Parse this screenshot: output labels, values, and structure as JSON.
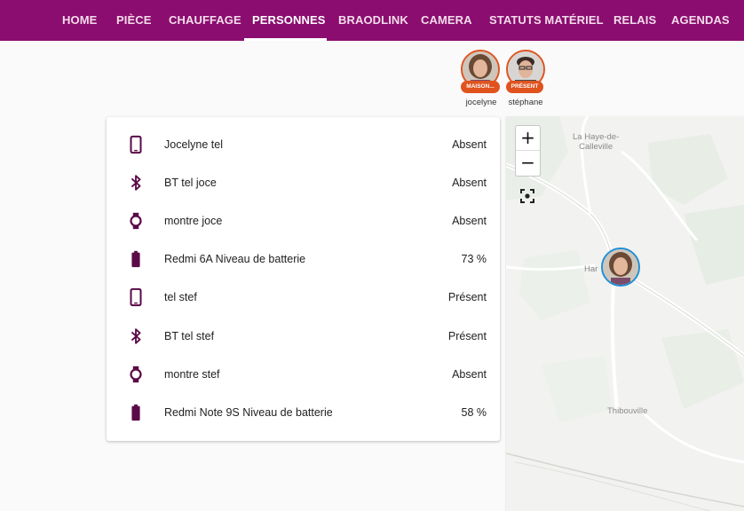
{
  "nav": {
    "tabs": [
      "HOME",
      "PIÈCE",
      "CHAUFFAGE",
      "PERSONNES",
      "BRAODLINK",
      "CAMERA",
      "STATUTS MATÉRIEL",
      "RELAIS",
      "AGENDAS"
    ],
    "active_tab": "PERSONNES"
  },
  "persons": [
    {
      "name": "jocelyne",
      "badge": "MAISON..."
    },
    {
      "name": "stéphane",
      "badge": "PRÉSENT"
    }
  ],
  "entities": [
    {
      "icon": "cellphone-icon",
      "label": "Jocelyne tel",
      "state": "Absent"
    },
    {
      "icon": "bluetooth-icon",
      "label": "BT tel joce",
      "state": "Absent"
    },
    {
      "icon": "watch-icon",
      "label": "montre joce",
      "state": "Absent"
    },
    {
      "icon": "battery-icon",
      "label": "Redmi 6A Niveau de batterie",
      "state": "73 %"
    },
    {
      "icon": "cellphone-icon",
      "label": "tel stef",
      "state": "Présent"
    },
    {
      "icon": "bluetooth-icon",
      "label": "BT tel stef",
      "state": "Présent"
    },
    {
      "icon": "watch-icon",
      "label": "montre stef",
      "state": "Absent"
    },
    {
      "icon": "battery-icon",
      "label": "Redmi Note 9S Niveau de batterie",
      "state": "58 %"
    }
  ],
  "map": {
    "zoom_in": "+",
    "zoom_out": "−",
    "places": [
      "La Haye-de-",
      "Calleville",
      "Har",
      "Thibouville"
    ]
  },
  "colors": {
    "header": "#8a0d6f",
    "icon": "#5a0a47",
    "badge": "#e0531f",
    "marker_border": "#1f8fd6"
  }
}
